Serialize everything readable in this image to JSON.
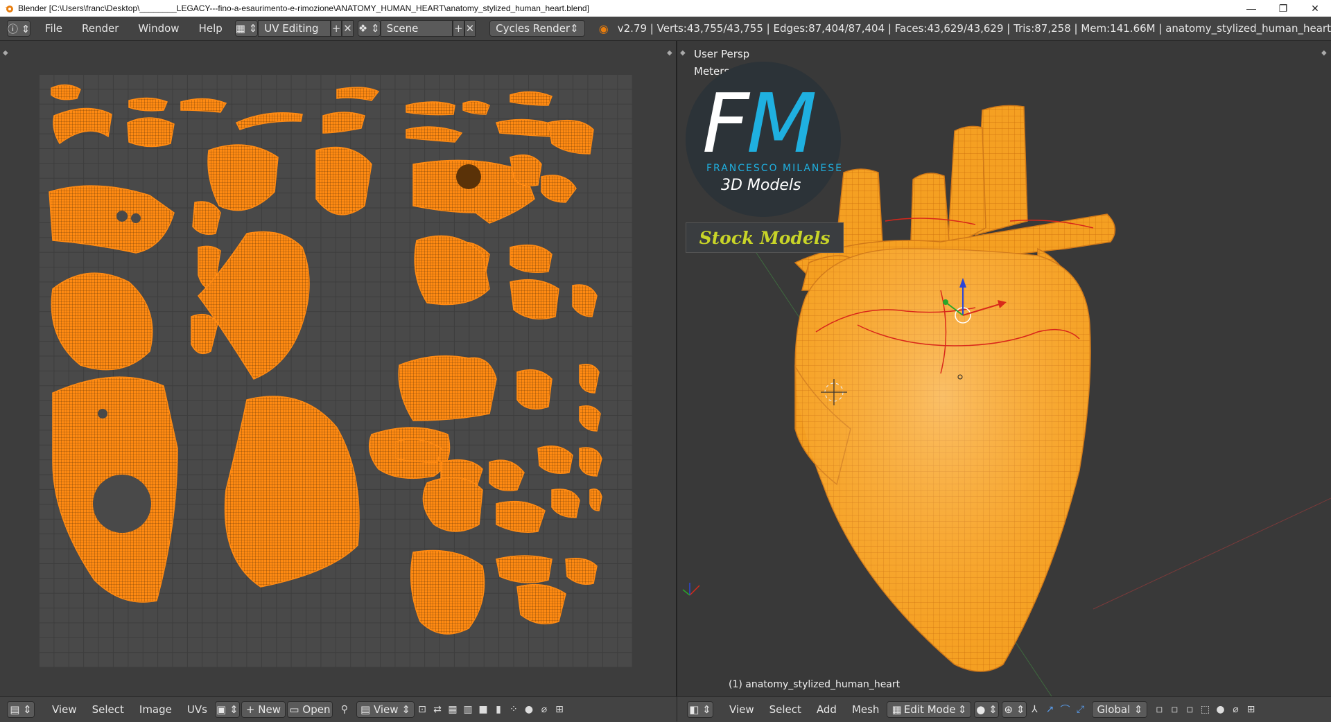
{
  "window": {
    "title": "Blender [C:\\Users\\franc\\Desktop\\________LEGACY---fino-a-esaurimento-e-rimozione\\ANATOMY_HUMAN_HEART\\anatomy_stylized_human_heart.blend]",
    "minimize": "—",
    "maximize": "❐",
    "close": "✕"
  },
  "topbar": {
    "menus": [
      "File",
      "Render",
      "Window",
      "Help"
    ],
    "layout": "UV Editing",
    "scene": "Scene",
    "engine": "Cycles Render",
    "stats": "v2.79 | Verts:43,755/43,755 | Edges:87,404/87,404 | Faces:43,629/43,629 | Tris:87,258 | Mem:141.66M | anatomy_stylized_human_heart"
  },
  "viewport": {
    "persp": "User Persp",
    "units": "Meters",
    "object_label": "(1) anatomy_stylized_human_heart"
  },
  "watermark": {
    "letters_f": "F",
    "letters_m": "M",
    "name": "FRANCESCO MILANESE",
    "sub": "3D Models",
    "stock": "Stock Models"
  },
  "uv_bottombar": {
    "items": [
      "View",
      "Select",
      "Image",
      "UVs"
    ],
    "new_label": "New",
    "open_label": "Open",
    "view_label": "View"
  },
  "view3d_bottombar": {
    "items": [
      "View",
      "Select",
      "Add",
      "Mesh"
    ],
    "mode": "Edit Mode",
    "orientation": "Global"
  },
  "colors": {
    "uv_orange": "#ff8a12",
    "heart_orange": "#f5a022",
    "fm_white": "#ffffff",
    "fm_blue": "#1fb0e0",
    "stock_text": "#c8d428"
  }
}
